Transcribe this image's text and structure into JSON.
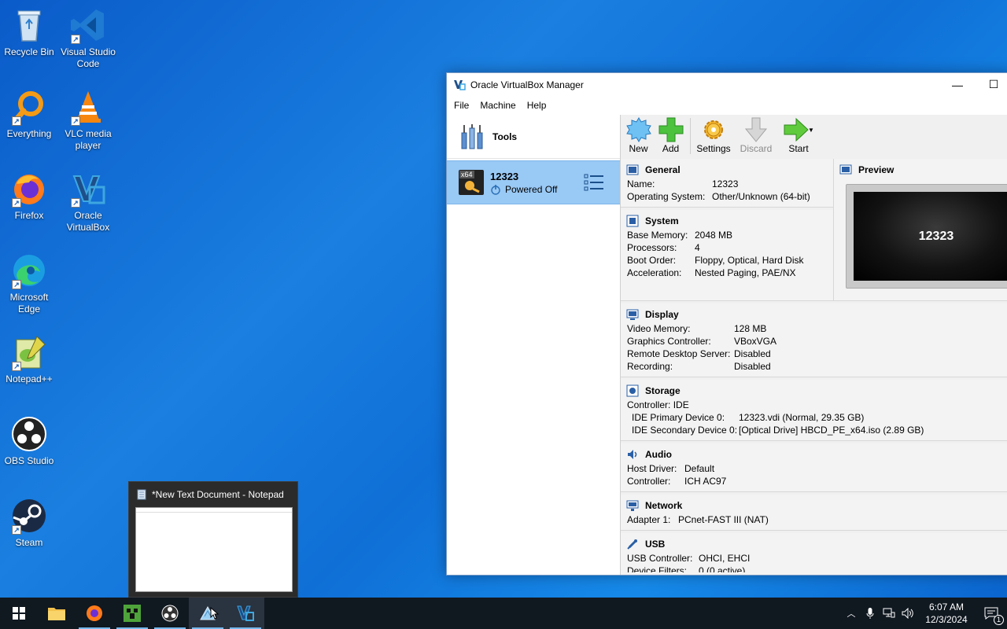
{
  "desktop": {
    "icons": [
      {
        "label": "Recycle Bin"
      },
      {
        "label": "Visual Studio Code"
      },
      {
        "label": "Everything"
      },
      {
        "label": "VLC media player"
      },
      {
        "label": "Firefox"
      },
      {
        "label": "Oracle VirtualBox"
      },
      {
        "label": "Microsoft Edge"
      },
      {
        "label": "Notepad++"
      },
      {
        "label": "OBS Studio"
      },
      {
        "label": "Steam"
      }
    ]
  },
  "window": {
    "title": "Oracle VirtualBox Manager",
    "minimize_glyph": "—",
    "maximize_glyph": "☐",
    "menu": [
      "File",
      "Machine",
      "Help"
    ],
    "tools_label": "Tools",
    "vm": {
      "name": "12323",
      "state": "Powered Off",
      "arch_badge": "x64"
    },
    "toolbar": {
      "new": "New",
      "add": "Add",
      "settings": "Settings",
      "discard": "Discard",
      "start": "Start"
    },
    "general": {
      "title": "General",
      "rows": [
        {
          "k": "Name:",
          "v": "12323"
        },
        {
          "k": "Operating System:",
          "v": "Other/Unknown (64-bit)"
        }
      ]
    },
    "system": {
      "title": "System",
      "rows": [
        {
          "k": "Base Memory:",
          "v": "2048 MB"
        },
        {
          "k": "Processors:",
          "v": "4"
        },
        {
          "k": "Boot Order:",
          "v": "Floppy, Optical, Hard Disk"
        },
        {
          "k": "Acceleration:",
          "v": "Nested Paging, PAE/NX"
        }
      ]
    },
    "preview": {
      "title": "Preview",
      "screen_text": "12323"
    },
    "display": {
      "title": "Display",
      "rows": [
        {
          "k": "Video Memory:",
          "v": "128 MB"
        },
        {
          "k": "Graphics Controller:",
          "v": "VBoxVGA"
        },
        {
          "k": "Remote Desktop Server:",
          "v": "Disabled"
        },
        {
          "k": "Recording:",
          "v": "Disabled"
        }
      ]
    },
    "storage": {
      "title": "Storage",
      "controller": "Controller: IDE",
      "rows": [
        {
          "k": "IDE Primary Device 0:",
          "v": "12323.vdi (Normal, 29.35 GB)"
        },
        {
          "k": "IDE Secondary Device 0:",
          "v": "[Optical Drive] HBCD_PE_x64.iso (2.89 GB)"
        }
      ]
    },
    "audio": {
      "title": "Audio",
      "rows": [
        {
          "k": "Host Driver:",
          "v": "Default"
        },
        {
          "k": "Controller:",
          "v": "ICH AC97"
        }
      ]
    },
    "network": {
      "title": "Network",
      "rows": [
        {
          "k": "Adapter 1:",
          "v": "PCnet-FAST III (NAT)"
        }
      ]
    },
    "usb": {
      "title": "USB",
      "rows": [
        {
          "k": "USB Controller:",
          "v": "OHCI, EHCI"
        },
        {
          "k": "Device Filters:",
          "v": "0 (0 active)"
        }
      ]
    }
  },
  "thumbnail": {
    "title": "*New Text Document - Notepad"
  },
  "taskbar": {
    "time": "6:07 AM",
    "date": "12/3/2024",
    "notif_count": "1"
  },
  "colors": {
    "accent": "#76b9ed",
    "selection": "#99c9f5",
    "taskbar": "#101820"
  }
}
